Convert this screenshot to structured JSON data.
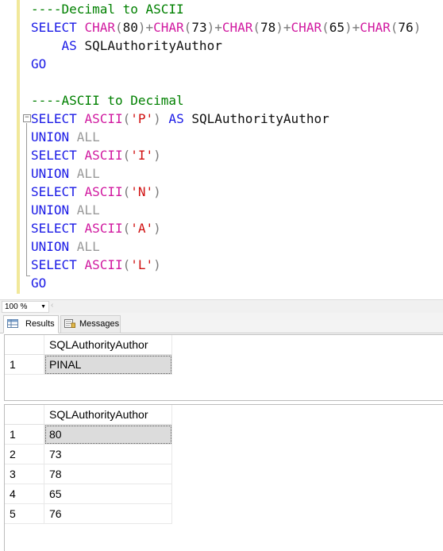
{
  "editor": {
    "lines": [
      [
        {
          "c": "cm",
          "t": "----Decimal to ASCII"
        }
      ],
      [
        {
          "c": "kw",
          "t": "SELECT "
        },
        {
          "c": "fn",
          "t": "CHAR"
        },
        {
          "c": "op",
          "t": "("
        },
        {
          "c": "tx",
          "t": "80"
        },
        {
          "c": "op",
          "t": ")+"
        },
        {
          "c": "fn",
          "t": "CHAR"
        },
        {
          "c": "op",
          "t": "("
        },
        {
          "c": "tx",
          "t": "73"
        },
        {
          "c": "op",
          "t": ")+"
        },
        {
          "c": "fn",
          "t": "CHAR"
        },
        {
          "c": "op",
          "t": "("
        },
        {
          "c": "tx",
          "t": "78"
        },
        {
          "c": "op",
          "t": ")+"
        },
        {
          "c": "fn",
          "t": "CHAR"
        },
        {
          "c": "op",
          "t": "("
        },
        {
          "c": "tx",
          "t": "65"
        },
        {
          "c": "op",
          "t": ")+"
        },
        {
          "c": "fn",
          "t": "CHAR"
        },
        {
          "c": "op",
          "t": "("
        },
        {
          "c": "tx",
          "t": "76"
        },
        {
          "c": "op",
          "t": ")"
        }
      ],
      [
        {
          "c": "tx",
          "t": "    "
        },
        {
          "c": "kw",
          "t": "AS "
        },
        {
          "c": "tx",
          "t": "SQLAuthorityAuthor"
        }
      ],
      [
        {
          "c": "kw",
          "t": "GO"
        }
      ],
      [
        {
          "c": "tx",
          "t": ""
        }
      ],
      [
        {
          "c": "cm",
          "t": "----ASCII to Decimal"
        }
      ],
      [
        {
          "c": "kw",
          "t": "SELECT "
        },
        {
          "c": "fn",
          "t": "ASCII"
        },
        {
          "c": "op",
          "t": "("
        },
        {
          "c": "st",
          "t": "'P'"
        },
        {
          "c": "op",
          "t": ")"
        },
        {
          "c": "kw",
          "t": " AS "
        },
        {
          "c": "tx",
          "t": "SQLAuthorityAuthor"
        }
      ],
      [
        {
          "c": "kw",
          "t": "UNION "
        },
        {
          "c": "gy",
          "t": "ALL"
        }
      ],
      [
        {
          "c": "kw",
          "t": "SELECT "
        },
        {
          "c": "fn",
          "t": "ASCII"
        },
        {
          "c": "op",
          "t": "("
        },
        {
          "c": "st",
          "t": "'I'"
        },
        {
          "c": "op",
          "t": ")"
        }
      ],
      [
        {
          "c": "kw",
          "t": "UNION "
        },
        {
          "c": "gy",
          "t": "ALL"
        }
      ],
      [
        {
          "c": "kw",
          "t": "SELECT "
        },
        {
          "c": "fn",
          "t": "ASCII"
        },
        {
          "c": "op",
          "t": "("
        },
        {
          "c": "st",
          "t": "'N'"
        },
        {
          "c": "op",
          "t": ")"
        }
      ],
      [
        {
          "c": "kw",
          "t": "UNION "
        },
        {
          "c": "gy",
          "t": "ALL"
        }
      ],
      [
        {
          "c": "kw",
          "t": "SELECT "
        },
        {
          "c": "fn",
          "t": "ASCII"
        },
        {
          "c": "op",
          "t": "("
        },
        {
          "c": "st",
          "t": "'A'"
        },
        {
          "c": "op",
          "t": ")"
        }
      ],
      [
        {
          "c": "kw",
          "t": "UNION "
        },
        {
          "c": "gy",
          "t": "ALL"
        }
      ],
      [
        {
          "c": "kw",
          "t": "SELECT "
        },
        {
          "c": "fn",
          "t": "ASCII"
        },
        {
          "c": "op",
          "t": "("
        },
        {
          "c": "st",
          "t": "'L'"
        },
        {
          "c": "op",
          "t": ")"
        }
      ],
      [
        {
          "c": "kw",
          "t": "GO"
        }
      ]
    ],
    "fold_icon": "minus"
  },
  "zoom": {
    "value": "100 %",
    "dropdown_icon": "chevron-down-icon"
  },
  "tabs": {
    "results": "Results",
    "messages": "Messages"
  },
  "grid1": {
    "header": "SQLAuthorityAuthor",
    "rows": [
      {
        "n": "1",
        "v": "PINAL"
      }
    ]
  },
  "grid2": {
    "header": "SQLAuthorityAuthor",
    "rows": [
      {
        "n": "1",
        "v": "80"
      },
      {
        "n": "2",
        "v": "73"
      },
      {
        "n": "3",
        "v": "78"
      },
      {
        "n": "4",
        "v": "65"
      },
      {
        "n": "5",
        "v": "76"
      }
    ]
  }
}
